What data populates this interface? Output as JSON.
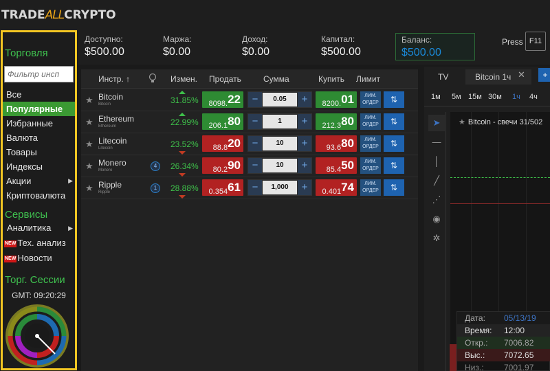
{
  "logo": {
    "part1": "TRADE",
    "part2": "ALL",
    "part3": "CRYPTO"
  },
  "sidebar": {
    "trading_heading": "Торговля",
    "filter_placeholder": "Фильтр инсп",
    "items": [
      {
        "label": "Все"
      },
      {
        "label": "Популярные",
        "active": true
      },
      {
        "label": "Избранные"
      },
      {
        "label": "Валюта"
      },
      {
        "label": "Товары"
      },
      {
        "label": "Индексы"
      },
      {
        "label": "Акции",
        "arrow": "▶"
      },
      {
        "label": "Криптовалюта"
      }
    ],
    "services_heading": "Сервисы",
    "services": [
      {
        "label": "Аналитика",
        "arrow": "▶"
      },
      {
        "label": "Тех. анализ",
        "badge": "NEW"
      },
      {
        "label": "Новости",
        "badge": "NEW"
      }
    ],
    "sessions_heading": "Торг. Сессии",
    "gmt": "GMT: 09:20:29"
  },
  "stats": {
    "available_label": "Доступно:",
    "available_value": "$500.00",
    "margin_label": "Маржа:",
    "margin_value": "$0.00",
    "income_label": "Доход:",
    "income_value": "$0.00",
    "capital_label": "Капитал:",
    "capital_value": "$500.00",
    "balance_label": "Баланс:",
    "balance_value": "$500.00",
    "press_label": "Press",
    "f11_label": "F11"
  },
  "table": {
    "headers": {
      "instrument": "Инстр.",
      "change": "Измен.",
      "sell": "Продать",
      "amount": "Сумма",
      "buy": "Купить",
      "limit": "Лимит"
    },
    "sort_arrow": "↑",
    "limit_btn": "ЛИМ. ОРДЕР",
    "alert_icon_glyph": "⇅",
    "rows": [
      {
        "name": "Bitcoin",
        "sub": "Bitcoin",
        "badge": "",
        "change": "31.85%",
        "trend": "up",
        "sell_small": "8098.",
        "sell_big": "22",
        "sell_color": "green",
        "qty": "0.05",
        "buy_small": "8200.",
        "buy_big": "01",
        "buy_color": "green"
      },
      {
        "name": "Ethereum",
        "sub": "Ethereum",
        "badge": "",
        "change": "22.99%",
        "trend": "up",
        "sell_small": "206.1",
        "sell_big": "80",
        "sell_color": "green",
        "qty": "1",
        "buy_small": "212.3",
        "buy_big": "80",
        "buy_color": "green"
      },
      {
        "name": "Litecoin",
        "sub": "Litecoin",
        "badge": "",
        "change": "23.52%",
        "trend": "down",
        "sell_small": "88.8",
        "sell_big": "20",
        "sell_color": "red",
        "qty": "10",
        "buy_small": "93.6",
        "buy_big": "80",
        "buy_color": "red"
      },
      {
        "name": "Monero",
        "sub": "Monero",
        "badge": "4",
        "change": "26.34%",
        "trend": "down",
        "sell_small": "80.2",
        "sell_big": "90",
        "sell_color": "red",
        "qty": "10",
        "buy_small": "85.4",
        "buy_big": "50",
        "buy_color": "red"
      },
      {
        "name": "Ripple",
        "sub": "Ripple",
        "badge": "1",
        "change": "28.88%",
        "trend": "down",
        "sell_small": "0.354",
        "sell_big": "61",
        "sell_color": "red",
        "qty": "1,000",
        "buy_small": "0.401",
        "buy_big": "74",
        "buy_color": "red"
      }
    ]
  },
  "chart": {
    "tab_tv": "TV",
    "tab_active": "Bitcoin 1ч",
    "timeframes": [
      {
        "label": "1м"
      },
      {
        "label": "5м"
      },
      {
        "label": "15м"
      },
      {
        "label": "30м"
      },
      {
        "label": "1ч",
        "selected": true
      },
      {
        "label": "4ч"
      }
    ],
    "title": "Bitcoin - свечи 31/502",
    "info": {
      "date_label": "Дата:",
      "date_value": "05/13/19",
      "time_label": "Время:",
      "time_value": "12:00",
      "open_label": "Откр.:",
      "open_value": "7006.82",
      "high_label": "Выс.:",
      "high_value": "7072.65",
      "low_label": "Низ.:",
      "low_value": "7001.97"
    }
  },
  "colors": {
    "accent_green": "#3fc24f",
    "sidebar_border": "#f3c623",
    "buy_green": "#2e8b33",
    "sell_red": "#b22222",
    "blue": "#1e63b0"
  }
}
